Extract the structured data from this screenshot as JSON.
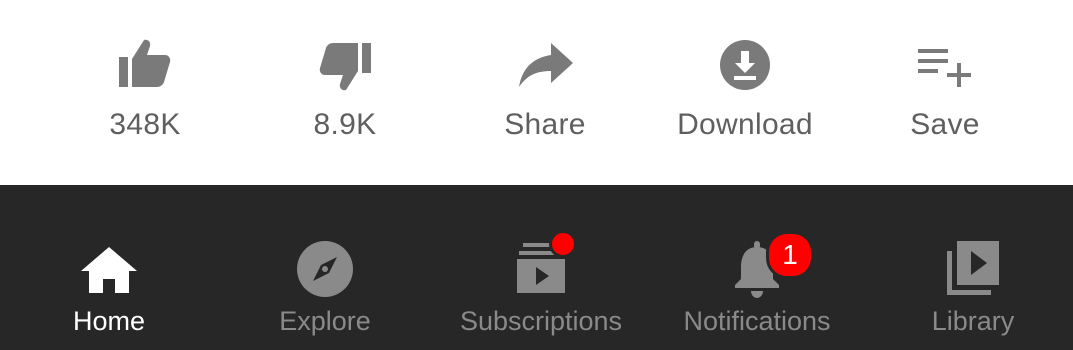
{
  "actions": {
    "like": {
      "label": "348K",
      "icon": "thumbs-up-icon"
    },
    "dislike": {
      "label": "8.9K",
      "icon": "thumbs-down-icon"
    },
    "share": {
      "label": "Share",
      "icon": "share-arrow-icon"
    },
    "download": {
      "label": "Download",
      "icon": "download-icon"
    },
    "save": {
      "label": "Save",
      "icon": "playlist-add-icon"
    }
  },
  "nav": {
    "home": {
      "label": "Home",
      "icon": "home-icon",
      "active": true
    },
    "explore": {
      "label": "Explore",
      "icon": "compass-icon"
    },
    "subscriptions": {
      "label": "Subscriptions",
      "icon": "subscriptions-icon",
      "has_new": true
    },
    "notifications": {
      "label": "Notifications",
      "icon": "bell-icon",
      "badge": "1"
    },
    "library": {
      "label": "Library",
      "icon": "library-icon"
    }
  },
  "colors": {
    "actions_background": "#ffffff",
    "action_icon": "#7a7a7a",
    "action_text": "#5f5f5f",
    "nav_background": "#272727",
    "nav_active": "#ffffff",
    "nav_inactive": "#8a8a8a",
    "badge": "#ff0000"
  }
}
